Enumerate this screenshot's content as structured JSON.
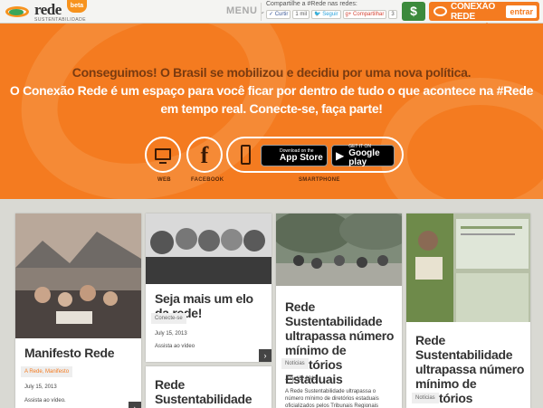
{
  "header": {
    "logo_text": "rede",
    "logo_subtext": "SUSTENTABILIDADE",
    "beta_label": "beta",
    "menu_label": "MENU",
    "share_label": "Compartilhe a #Rede nas redes:",
    "share_buttons": {
      "curtir": "Curtir",
      "curtir_count": "1 mil",
      "seguir": "Seguir",
      "compartilhar": "Compartilhar",
      "compartilhar_count": "3"
    },
    "dollar_icon": "dollar-icon",
    "connect_label": "CONEXÃO REDE",
    "login_label": "entrar"
  },
  "hero": {
    "line1": "Conseguimos! O Brasil se mobilizou e decidiu por uma nova política.",
    "line2": "O Conexão Rede é um espaço para você ficar por dentro de tudo o que acontece na #Rede",
    "line3": "em tempo real. Conecte-se, faça parte!",
    "web_label": "WEB",
    "facebook_label": "FACEBOOK",
    "smartphone_label": "SMARTPHONE",
    "appstore_small": "Download on the",
    "appstore_big": "App Store",
    "gplay_small": "GET IT ON",
    "gplay_big": "Google play",
    "colors": {
      "orange": "#f47b20",
      "dark_text": "#7a3b10"
    }
  },
  "cards": [
    {
      "title": "Manifesto Rede",
      "tag": "A Rede, Manifesto",
      "date": "July 15, 2013",
      "excerpt": "Assista ao vídeo."
    },
    {
      "title": "Seja mais um elo da rede!",
      "tag": "Conecte-se",
      "date": "July 15, 2013",
      "excerpt": "Assista ao vídeo"
    },
    {
      "title": "Rede Sustentabilidade reafirma que não",
      "tag": "",
      "date": "",
      "excerpt": ""
    },
    {
      "title": "Rede Sustentabilidade ultrapassa número mínimo de Diretórios Estaduais",
      "tag": "Notícias",
      "date": "July 15, 2013",
      "excerpt": "A Rede Sustentabilidade ultrapassa o número mínimo de diretórios estaduais oficializados pelos Tribunais Regionais Eleitorais (TREs) para"
    },
    {
      "title": "Rede Sustentabilidade ultrapassa número mínimo de Diretórios Estaduais",
      "tag": "Notícias",
      "date": "",
      "excerpt": ""
    }
  ]
}
